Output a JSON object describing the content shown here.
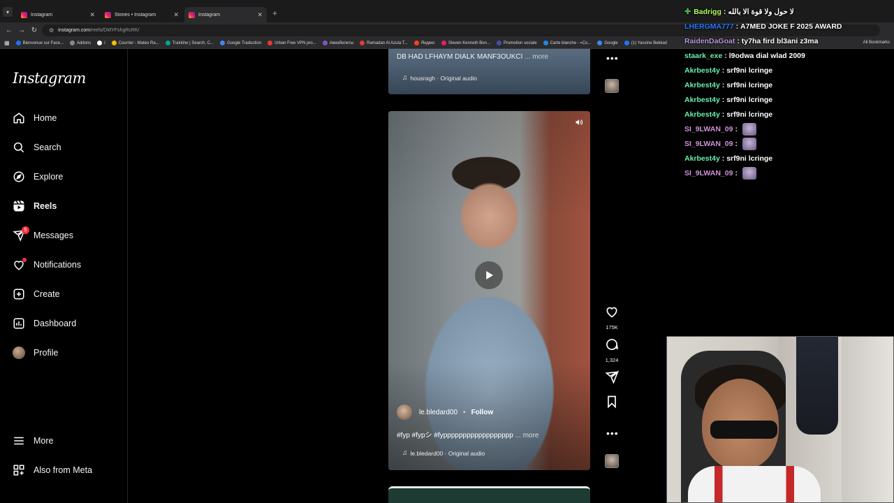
{
  "browser": {
    "tabs": [
      {
        "title": "Instagram",
        "active": false
      },
      {
        "title": "Stories • Instagram",
        "active": false
      },
      {
        "title": "Instagram",
        "active": true
      }
    ],
    "url_host": "instagram.com",
    "url_path": "/reels/DMYFshgRcRK/",
    "bookmarks": [
      {
        "label": "Bienvenue sur Face...",
        "color": "#1877f2"
      },
      {
        "label": "Addons",
        "color": "#888888"
      },
      {
        "label": "i",
        "color": "#ffffff"
      },
      {
        "label": "Courrier - Mateo Ra...",
        "color": "#fbbc04"
      },
      {
        "label": "Trainline | Search, C...",
        "color": "#00a88f"
      },
      {
        "label": "Google Traduction",
        "color": "#4285f4"
      },
      {
        "label": "Urban Free VPN pro...",
        "color": "#e53935"
      },
      {
        "label": "Авиабилеты",
        "color": "#7e57c2"
      },
      {
        "label": "Ramadan Al Azula T...",
        "color": "#e53935"
      },
      {
        "label": "Яндекс",
        "color": "#fc3f1d"
      },
      {
        "label": "Steven Kenneth Bon...",
        "color": "#e91e63"
      },
      {
        "label": "Promotion sociale",
        "color": "#3f51b5"
      },
      {
        "label": "Carte blanche - «Co...",
        "color": "#1e88e5"
      },
      {
        "label": "Google",
        "color": "#4285f4"
      },
      {
        "label": "(1) Yassine Bekkari",
        "color": "#1877f2"
      }
    ],
    "all_bookmarks": "All Bookmarks"
  },
  "instagram": {
    "logo": "Instagram",
    "nav": [
      {
        "label": "Home",
        "icon": "home-icon"
      },
      {
        "label": "Search",
        "icon": "search-icon"
      },
      {
        "label": "Explore",
        "icon": "compass-icon"
      },
      {
        "label": "Reels",
        "icon": "reels-icon"
      },
      {
        "label": "Messages",
        "icon": "messages-icon",
        "badge": "5"
      },
      {
        "label": "Notifications",
        "icon": "heart-icon"
      },
      {
        "label": "Create",
        "icon": "plus-square-icon"
      },
      {
        "label": "Dashboard",
        "icon": "chart-icon"
      },
      {
        "label": "Profile",
        "icon": "avatar"
      }
    ],
    "more": "More",
    "also_from_meta": "Also from Meta"
  },
  "reel_prev": {
    "caption": "DB HAD LFHAYM DIALK MANF3OUKCI",
    "more": "... more",
    "audio": "housragh · Original audio"
  },
  "reel": {
    "username": "le.bledard00",
    "follow": "Follow",
    "caption": "#fyp #fypシ #fypppppppppppppppppp",
    "more": "... more",
    "audio": "le.bledard00 · Original audio",
    "likes": "175K",
    "comments": "1,324"
  },
  "chat": [
    {
      "name": "Badrigg",
      "text": "لا حول ولا قوة الا بالله",
      "color": "#b2ff59",
      "icon": true
    },
    {
      "name": "LHERGMA777",
      "text": "A7MED JOKE F 2025 AWARD",
      "color": "#2979ff"
    },
    {
      "name": "RaidenDaGoat",
      "text": "ty7ha fird bl3ani z3ma",
      "color": "#b39ddb"
    },
    {
      "name": "staark_exe",
      "text": "l9odwa dial wlad 2009",
      "color": "#69f0ae"
    },
    {
      "name": "Akrbest4y",
      "text": "srf9ni lcringe",
      "color": "#69f0ae"
    },
    {
      "name": "Akrbest4y",
      "text": "srf9ni lcringe",
      "color": "#69f0ae"
    },
    {
      "name": "Akrbest4y",
      "text": "srf9ni lcringe",
      "color": "#69f0ae"
    },
    {
      "name": "Akrbest4y",
      "text": "srf9ni lcringe",
      "color": "#69f0ae"
    },
    {
      "name": "SI_9LWAN_09",
      "text": "",
      "color": "#ce93d8",
      "emote": true
    },
    {
      "name": "SI_9LWAN_09",
      "text": "",
      "color": "#ce93d8",
      "emote": true
    },
    {
      "name": "Akrbest4y",
      "text": "srf9ni lcringe",
      "color": "#69f0ae"
    },
    {
      "name": "SI_9LWAN_09",
      "text": "",
      "color": "#ce93d8",
      "emote": true
    }
  ],
  "colors": {
    "accent": "#ff3040",
    "background": "#000000"
  }
}
